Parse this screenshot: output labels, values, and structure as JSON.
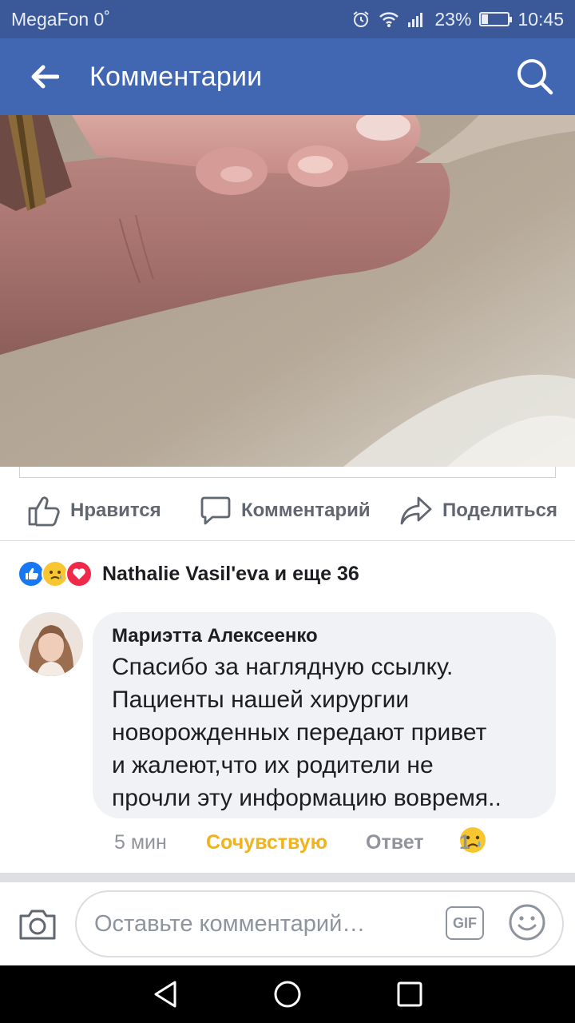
{
  "status_bar": {
    "carrier": "MegaFon 0˚",
    "battery": "23%",
    "battery_level": 0.23,
    "time": "10:45"
  },
  "app_bar": {
    "title": "Комментарии"
  },
  "actions": {
    "like": "Нравится",
    "comment": "Комментарий",
    "share": "Поделиться"
  },
  "reactions": {
    "summary": "Nathalie Vasil'eva и еще 36",
    "icons": [
      "like-icon",
      "sad-icon",
      "love-icon"
    ],
    "colors": {
      "like": "#1877f2",
      "sad": "#f7c631",
      "love": "#f0284a"
    }
  },
  "comment": {
    "author": "Мариэтта Алексеенко",
    "lines": [
      "Спасибо за наглядную ссылку.",
      "Пациенты нашей хирургии",
      "новорожденных передают привет",
      "и жалеют,что их родители не",
      "прочли эту информацию вовремя.."
    ],
    "time": "5 мин",
    "reaction_label": "Сочувствую",
    "reply": "Ответ",
    "reaction_count": "1"
  },
  "composer": {
    "placeholder": "Оставьте комментарий…",
    "gif": "GIF"
  },
  "theme": {
    "header_bg": "#4267b2",
    "status_bg": "#3b5998",
    "reaction_sad_color": "#f2b21b"
  }
}
